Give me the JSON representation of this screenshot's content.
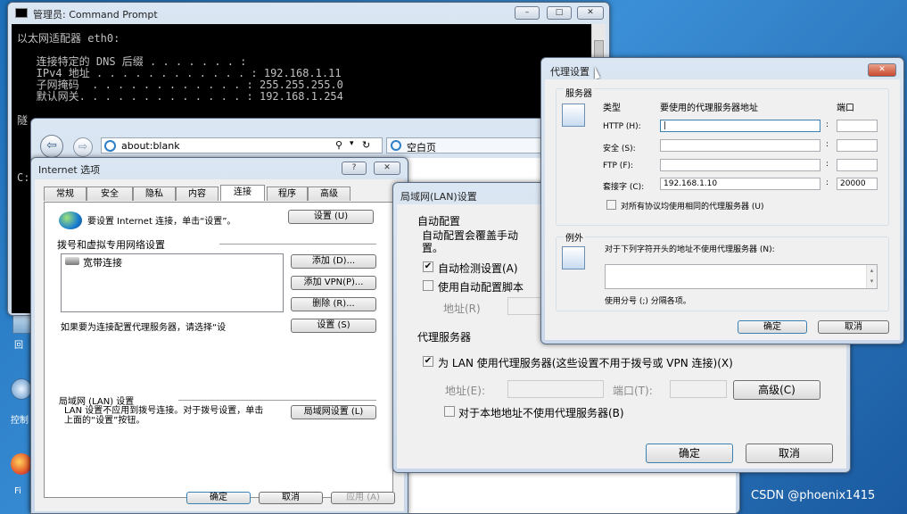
{
  "cmd": {
    "title": "管理员: Command Prompt",
    "lines": [
      "以太网适配器 eth0:",
      "",
      "   连接特定的 DNS 后缀 . . . . . . . :",
      "   IPv4 地址 . . . . . . . . . . . . : 192.168.1.11",
      "   子网掩码  . . . . . . . . . . . . : 255.255.255.0",
      "   默认网关. . . . . . . . . . . . . : 192.168.1.254"
    ],
    "c_frag": "C:",
    "sui_frag": "隧"
  },
  "desktop": {
    "icon1": "回",
    "icon2": "控制",
    "icon3": "Fi"
  },
  "browser": {
    "address": "about:blank",
    "tab": "空白页"
  },
  "io": {
    "title": "Internet 选项",
    "tabs": [
      "常规",
      "安全",
      "隐私",
      "内容",
      "连接",
      "程序",
      "高级"
    ],
    "setup_text": "要设置 Internet 连接，单击“设置”。",
    "setup_btn": "设置 (U)",
    "dialup_header": "拨号和虚拟专用网络设置",
    "list_item": "宽带连接",
    "add_btn": "添加 (D)...",
    "add_vpn_btn": "添加 VPN(P)...",
    "remove_btn": "删除 (R)...",
    "proxy_text": "如果要为连接配置代理服务器，请选择“设",
    "settings_btn": "设置 (S)",
    "lan_header": "局域网 (LAN) 设置",
    "lan_text": "LAN 设置不应用到拨号连接。对于拨号设置，单击上面的“设置”按钮。",
    "lan_btn": "局域网设置 (L)",
    "ok": "确定",
    "cancel": "取消",
    "apply": "应用 (A)"
  },
  "lan": {
    "title": "局域网(LAN)设置",
    "auto_header": "自动配置",
    "auto_desc": "自动配置会覆盖手动",
    "auto_desc2": "置。",
    "auto_detect": "自动检测设置(A)",
    "use_script": "使用自动配置脚本",
    "addr_label": "地址(R)",
    "proxy_header": "代理服务器",
    "use_proxy": "为 LAN 使用代理服务器(这些设置不用于拨号或 VPN 连接)(X)",
    "address_label": "地址(E):",
    "port_label": "端口(T):",
    "advanced": "高级(C)",
    "bypass_local": "对于本地地址不使用代理服务器(B)",
    "ok": "确定",
    "cancel": "取消"
  },
  "proxy": {
    "title": "代理设置",
    "servers_label": "服务器",
    "col_type": "类型",
    "col_addr": "要使用的代理服务器地址",
    "col_port": "端口",
    "rows": [
      {
        "type": "HTTP (H):",
        "addr": "",
        "port": ""
      },
      {
        "type": "安全 (S):",
        "addr": "",
        "port": ""
      },
      {
        "type": "FTP (F):",
        "addr": "",
        "port": ""
      },
      {
        "type": "套接字 (C):",
        "addr": "192.168.1.10",
        "port": "20000"
      }
    ],
    "same_all": "对所有协议均使用相同的代理服务器 (U)",
    "exceptions_label": "例外",
    "exceptions_desc": "对于下列字符开头的地址不使用代理服务器 (N):",
    "semicolon_hint": "使用分号 (;) 分隔各项。",
    "ok": "确定",
    "cancel": "取消"
  },
  "watermark": "CSDN @phoenix1415"
}
